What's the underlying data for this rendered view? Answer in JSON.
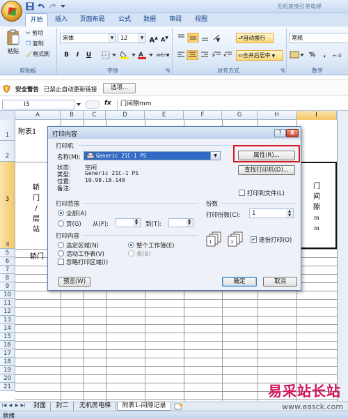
{
  "window": {
    "title": "无机房曳引单电梯"
  },
  "tabs": [
    {
      "label": "开始"
    },
    {
      "label": "插入"
    },
    {
      "label": "页面布局"
    },
    {
      "label": "公式"
    },
    {
      "label": "数据"
    },
    {
      "label": "审阅"
    },
    {
      "label": "视图"
    }
  ],
  "ribbon": {
    "clipboard": {
      "paste": "粘贴",
      "cut": "剪切",
      "copy": "复制",
      "format_painter": "格式刷",
      "group": "剪贴板"
    },
    "font": {
      "name": "宋体",
      "size": "12",
      "bold": "B",
      "italic": "I",
      "underline": "U",
      "group": "字体",
      "grow": "A",
      "shrink": "A",
      "phonetic": "wén"
    },
    "alignment": {
      "wrap": "自动换行",
      "merge": "合并后居中",
      "group": "对齐方式"
    },
    "number": {
      "format": "常规",
      "percent": "%",
      "comma": ",",
      "group": "数字"
    }
  },
  "security": {
    "title": "安全警告",
    "message": "已禁止自动更新链接",
    "options": "选项..."
  },
  "formula_bar": {
    "cell": "I3",
    "fx": "fx",
    "value": "门间隙mm"
  },
  "columns": [
    "A",
    "B",
    "C",
    "D",
    "E",
    "F",
    "G",
    "H",
    "I"
  ],
  "rows": [
    "1",
    "2",
    "3",
    "4",
    "5",
    "6",
    "7",
    "8",
    "9",
    "10",
    "11",
    "12",
    "13",
    "14",
    "15",
    "16",
    "17",
    "18",
    "19",
    "20",
    "21"
  ],
  "cells": {
    "a1": "附表1",
    "a3": [
      "轿",
      "门",
      "/",
      "层",
      "站"
    ],
    "a5": "轿门",
    "i3": [
      "门",
      "间",
      "隙",
      "m",
      "m"
    ]
  },
  "dialog": {
    "title": "打印内容",
    "help": "?",
    "close": "X",
    "printer_section": "打印机",
    "name_label": "名称(M):",
    "printer_name": "Generic 21C-1 PS",
    "status_label": "状态:",
    "status_value": "空闲",
    "type_label": "类型:",
    "type_value": "Generic 21C-1 PS",
    "location_label": "位置:",
    "location_value": "10.98.18.140",
    "comment_label": "备注:",
    "properties_button": "属性(R)...",
    "find_printer_button": "查找打印机(D)...",
    "print_to_file": "打印到文件(L)",
    "range_section": "打印范围",
    "range_all": "全部(A)",
    "range_pages": "页(G)",
    "from_label": "从(F):",
    "to_label": "到(T):",
    "content_section": "打印内容",
    "selection": "选定区域(N)",
    "active_sheet": "活动工作表(V)",
    "workbook": "整个工作簿(E)",
    "table": "表(B)",
    "ignore_area": "忽略打印区域(I)",
    "copies_section": "份数",
    "copies_label": "打印份数(C):",
    "copies_value": "1",
    "collate": "逐份打印(O)",
    "preview_button": "预览(W)",
    "ok_button": "确定",
    "cancel_button": "取消"
  },
  "sheets": [
    {
      "label": "封面"
    },
    {
      "label": "封二"
    },
    {
      "label": "无机房电梯"
    },
    {
      "label": "附表1-间隙记录"
    }
  ],
  "status": {
    "text": "就绪"
  },
  "watermark": {
    "text": "易采站长站",
    "url": "www.easck.com"
  }
}
